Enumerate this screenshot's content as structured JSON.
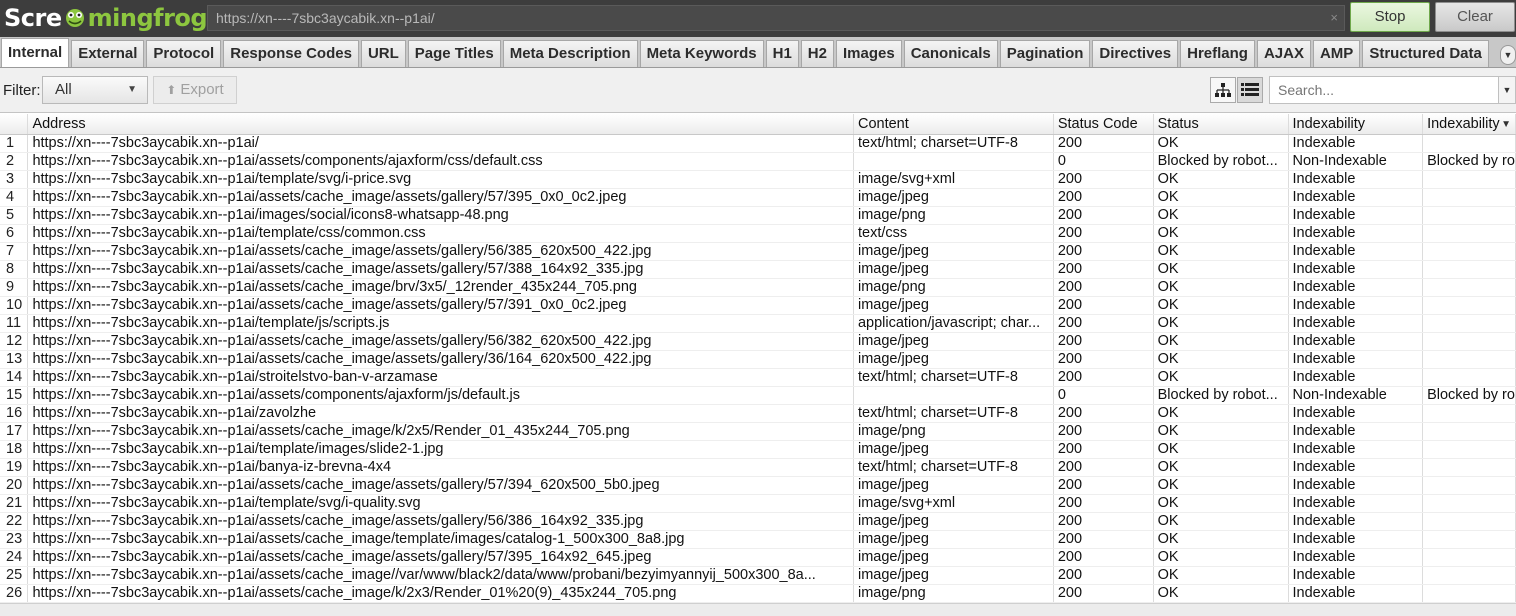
{
  "brand": {
    "part1": "Scre",
    "part2": "mingfrog",
    "accent": "#8dc63f"
  },
  "urlbar": {
    "value": "https://xn----7sbc3aycabik.xn--p1ai/",
    "clear_icon": "×"
  },
  "top_buttons": {
    "stop": "Stop",
    "clear": "Clear"
  },
  "tabs": [
    {
      "label": "Internal",
      "active": true
    },
    {
      "label": "External"
    },
    {
      "label": "Protocol"
    },
    {
      "label": "Response Codes"
    },
    {
      "label": "URL"
    },
    {
      "label": "Page Titles"
    },
    {
      "label": "Meta Description"
    },
    {
      "label": "Meta Keywords"
    },
    {
      "label": "H1"
    },
    {
      "label": "H2"
    },
    {
      "label": "Images"
    },
    {
      "label": "Canonicals"
    },
    {
      "label": "Pagination"
    },
    {
      "label": "Directives"
    },
    {
      "label": "Hreflang"
    },
    {
      "label": "AJAX"
    },
    {
      "label": "AMP"
    },
    {
      "label": "Structured Data"
    }
  ],
  "filter": {
    "label": "Filter:",
    "selected": "All",
    "export": "Export"
  },
  "search": {
    "placeholder": "Search..."
  },
  "table": {
    "columns": [
      "",
      "Address",
      "Content",
      "Status Code",
      "Status",
      "Indexability",
      "Indexability"
    ],
    "rows": [
      [
        "1",
        "https://xn----7sbc3aycabik.xn--p1ai/",
        "text/html; charset=UTF-8",
        "200",
        "OK",
        "Indexable",
        ""
      ],
      [
        "2",
        "https://xn----7sbc3aycabik.xn--p1ai/assets/components/ajaxform/css/default.css",
        "",
        "0",
        "Blocked by robot...",
        "Non-Indexable",
        "Blocked by ro"
      ],
      [
        "3",
        "https://xn----7sbc3aycabik.xn--p1ai/template/svg/i-price.svg",
        "image/svg+xml",
        "200",
        "OK",
        "Indexable",
        ""
      ],
      [
        "4",
        "https://xn----7sbc3aycabik.xn--p1ai/assets/cache_image/assets/gallery/57/395_0x0_0c2.jpeg",
        "image/jpeg",
        "200",
        "OK",
        "Indexable",
        ""
      ],
      [
        "5",
        "https://xn----7sbc3aycabik.xn--p1ai/images/social/icons8-whatsapp-48.png",
        "image/png",
        "200",
        "OK",
        "Indexable",
        ""
      ],
      [
        "6",
        "https://xn----7sbc3aycabik.xn--p1ai/template/css/common.css",
        "text/css",
        "200",
        "OK",
        "Indexable",
        ""
      ],
      [
        "7",
        "https://xn----7sbc3aycabik.xn--p1ai/assets/cache_image/assets/gallery/56/385_620x500_422.jpg",
        "image/jpeg",
        "200",
        "OK",
        "Indexable",
        ""
      ],
      [
        "8",
        "https://xn----7sbc3aycabik.xn--p1ai/assets/cache_image/assets/gallery/57/388_164x92_335.jpg",
        "image/jpeg",
        "200",
        "OK",
        "Indexable",
        ""
      ],
      [
        "9",
        "https://xn----7sbc3aycabik.xn--p1ai/assets/cache_image/brv/3x5/_12render_435x244_705.png",
        "image/png",
        "200",
        "OK",
        "Indexable",
        ""
      ],
      [
        "10",
        "https://xn----7sbc3aycabik.xn--p1ai/assets/cache_image/assets/gallery/57/391_0x0_0c2.jpeg",
        "image/jpeg",
        "200",
        "OK",
        "Indexable",
        ""
      ],
      [
        "11",
        "https://xn----7sbc3aycabik.xn--p1ai/template/js/scripts.js",
        "application/javascript; char...",
        "200",
        "OK",
        "Indexable",
        ""
      ],
      [
        "12",
        "https://xn----7sbc3aycabik.xn--p1ai/assets/cache_image/assets/gallery/56/382_620x500_422.jpg",
        "image/jpeg",
        "200",
        "OK",
        "Indexable",
        ""
      ],
      [
        "13",
        "https://xn----7sbc3aycabik.xn--p1ai/assets/cache_image/assets/gallery/36/164_620x500_422.jpg",
        "image/jpeg",
        "200",
        "OK",
        "Indexable",
        ""
      ],
      [
        "14",
        "https://xn----7sbc3aycabik.xn--p1ai/stroitelstvo-ban-v-arzamase",
        "text/html; charset=UTF-8",
        "200",
        "OK",
        "Indexable",
        ""
      ],
      [
        "15",
        "https://xn----7sbc3aycabik.xn--p1ai/assets/components/ajaxform/js/default.js",
        "",
        "0",
        "Blocked by robot...",
        "Non-Indexable",
        "Blocked by ro"
      ],
      [
        "16",
        "https://xn----7sbc3aycabik.xn--p1ai/zavolzhe",
        "text/html; charset=UTF-8",
        "200",
        "OK",
        "Indexable",
        ""
      ],
      [
        "17",
        "https://xn----7sbc3aycabik.xn--p1ai/assets/cache_image/k/2x5/Render_01_435x244_705.png",
        "image/png",
        "200",
        "OK",
        "Indexable",
        ""
      ],
      [
        "18",
        "https://xn----7sbc3aycabik.xn--p1ai/template/images/slide2-1.jpg",
        "image/jpeg",
        "200",
        "OK",
        "Indexable",
        ""
      ],
      [
        "19",
        "https://xn----7sbc3aycabik.xn--p1ai/banya-iz-brevna-4x4",
        "text/html; charset=UTF-8",
        "200",
        "OK",
        "Indexable",
        ""
      ],
      [
        "20",
        "https://xn----7sbc3aycabik.xn--p1ai/assets/cache_image/assets/gallery/57/394_620x500_5b0.jpeg",
        "image/jpeg",
        "200",
        "OK",
        "Indexable",
        ""
      ],
      [
        "21",
        "https://xn----7sbc3aycabik.xn--p1ai/template/svg/i-quality.svg",
        "image/svg+xml",
        "200",
        "OK",
        "Indexable",
        ""
      ],
      [
        "22",
        "https://xn----7sbc3aycabik.xn--p1ai/assets/cache_image/assets/gallery/56/386_164x92_335.jpg",
        "image/jpeg",
        "200",
        "OK",
        "Indexable",
        ""
      ],
      [
        "23",
        "https://xn----7sbc3aycabik.xn--p1ai/assets/cache_image/template/images/catalog-1_500x300_8a8.jpg",
        "image/jpeg",
        "200",
        "OK",
        "Indexable",
        ""
      ],
      [
        "24",
        "https://xn----7sbc3aycabik.xn--p1ai/assets/cache_image/assets/gallery/57/395_164x92_645.jpeg",
        "image/jpeg",
        "200",
        "OK",
        "Indexable",
        ""
      ],
      [
        "25",
        "https://xn----7sbc3aycabik.xn--p1ai/assets/cache_image//var/www/black2/data/www/probani/bezyimyannyij_500x300_8a...",
        "image/jpeg",
        "200",
        "OK",
        "Indexable",
        ""
      ],
      [
        "26",
        "https://xn----7sbc3aycabik.xn--p1ai/assets/cache_image/k/2x3/Render_01%20(9)_435x244_705.png",
        "image/png",
        "200",
        "OK",
        "Indexable",
        ""
      ]
    ]
  }
}
